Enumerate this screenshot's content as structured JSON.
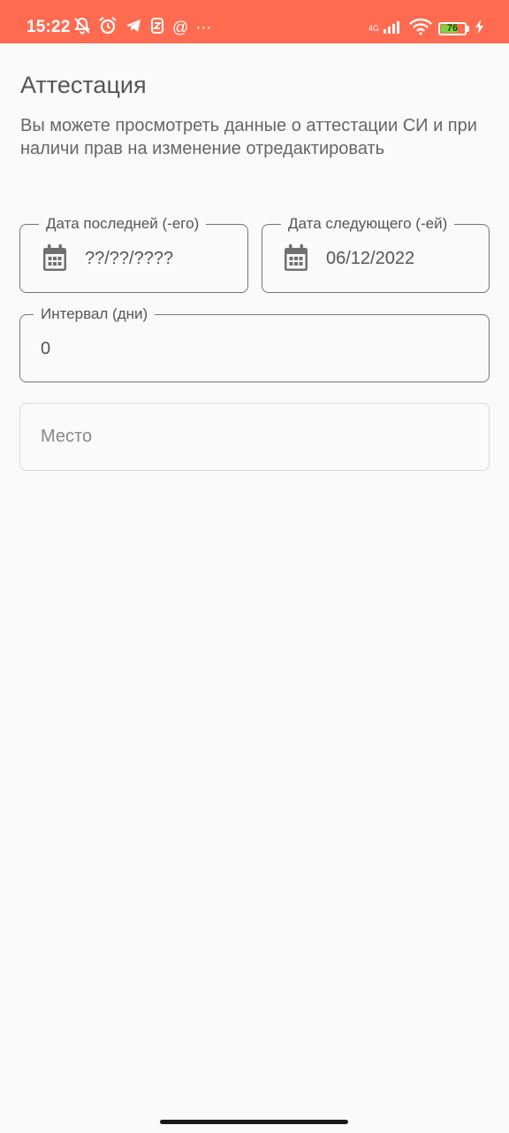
{
  "status_bar": {
    "time": "15:22",
    "network_type": "4G",
    "battery_level": "76",
    "left_icons": [
      "bell-off-icon",
      "alarm-icon",
      "telegram-icon",
      "app-icon",
      "at-icon",
      "more-icon"
    ],
    "right_icons": [
      "signal-icon",
      "wifi-icon",
      "battery-icon",
      "charging-icon"
    ],
    "colors": {
      "background": "#ff6b50",
      "battery": "#7bd142"
    }
  },
  "page": {
    "title": "Аттестация",
    "description": "Вы можете просмотреть данные о аттестации СИ и при наличи прав на изменение отредактировать"
  },
  "fields": {
    "last_date": {
      "label": "Дата последней (-его)",
      "value": "??/??/????",
      "icon": "calendar-icon"
    },
    "next_date": {
      "label": "Дата следующего (-ей)",
      "value": "06/12/2022",
      "icon": "calendar-icon"
    },
    "interval": {
      "label": "Интервал (дни)",
      "value": "0"
    },
    "place": {
      "placeholder": "Место",
      "value": ""
    }
  }
}
